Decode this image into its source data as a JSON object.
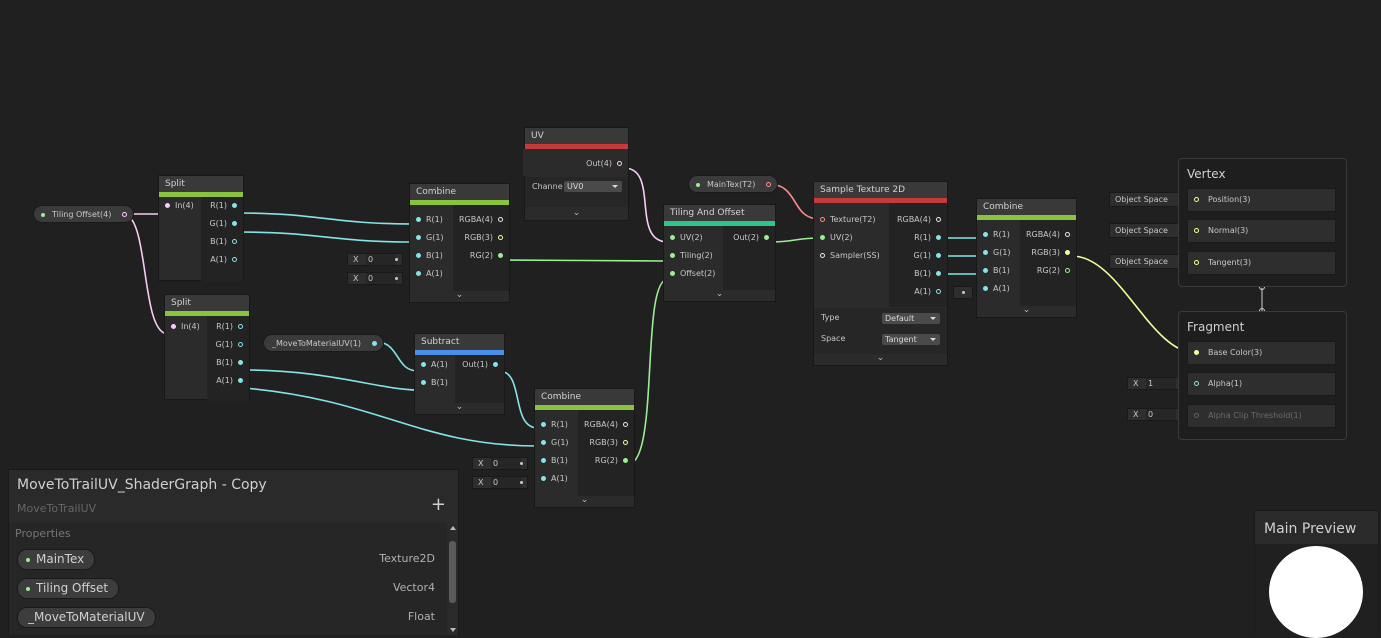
{
  "nodes": {
    "split1": {
      "title": "Split",
      "inputs": [
        "In(4)"
      ],
      "outputs": [
        "R(1)",
        "G(1)",
        "B(1)",
        "A(1)"
      ]
    },
    "split2": {
      "title": "Split",
      "inputs": [
        "In(4)"
      ],
      "outputs": [
        "R(1)",
        "G(1)",
        "B(1)",
        "A(1)"
      ]
    },
    "combine1": {
      "title": "Combine",
      "inputs": [
        "R(1)",
        "G(1)",
        "B(1)",
        "A(1)"
      ],
      "outputs": [
        "RGBA(4)",
        "RGB(3)",
        "RG(2)"
      ],
      "defaults": {
        "b": "0",
        "a": "0"
      }
    },
    "uv": {
      "title": "UV",
      "output": "Out(4)",
      "channel_label": "Channe",
      "channel_value": "UV0"
    },
    "subtract": {
      "title": "Subtract",
      "inputs": [
        "A(1)",
        "B(1)"
      ],
      "output": "Out(1)"
    },
    "combine2": {
      "title": "Combine",
      "inputs": [
        "R(1)",
        "G(1)",
        "B(1)",
        "A(1)"
      ],
      "outputs": [
        "RGBA(4)",
        "RGB(3)",
        "RG(2)"
      ],
      "defaults": {
        "b": "0",
        "a": "0"
      }
    },
    "tiling": {
      "title": "Tiling And Offset",
      "inputs": [
        "UV(2)",
        "Tiling(2)",
        "Offset(2)"
      ],
      "output": "Out(2)"
    },
    "sample": {
      "title": "Sample Texture 2D",
      "inputs": [
        "Texture(T2)",
        "UV(2)",
        "Sampler(SS)"
      ],
      "outputs": [
        "RGBA(4)",
        "R(1)",
        "G(1)",
        "B(1)",
        "A(1)"
      ],
      "type_label": "Type",
      "type_value": "Default",
      "space_label": "Space",
      "space_value": "Tangent"
    },
    "combine3": {
      "title": "Combine",
      "inputs": [
        "R(1)",
        "G(1)",
        "B(1)",
        "A(1)"
      ],
      "outputs": [
        "RGBA(4)",
        "RGB(3)",
        "RG(2)"
      ]
    }
  },
  "property_nodes": {
    "tiling_offset": "Tiling Offset(4)",
    "main_tex": "MainTex(T2)",
    "move_uv": "_MoveToMaterialUV(1)"
  },
  "vertex": {
    "title": "Vertex",
    "slots": [
      "Position(3)",
      "Normal(3)",
      "Tangent(3)"
    ],
    "spaces": [
      "Object Space",
      "Object Space",
      "Object Space"
    ]
  },
  "fragment": {
    "title": "Fragment",
    "slots": [
      "Base Color(3)",
      "Alpha(1)",
      "Alpha Clip Threshold(1)"
    ],
    "alpha_value": "1",
    "clip_value": "0"
  },
  "blackboard": {
    "title": "MoveToTrailUV_ShaderGraph - Copy",
    "subtitle": "MoveToTrailUV",
    "add_label": "+",
    "section": "Properties",
    "properties": [
      {
        "name": "MainTex",
        "type": "Texture2D"
      },
      {
        "name": "Tiling Offset",
        "type": "Vector4"
      },
      {
        "name": "_MoveToMaterialUV",
        "type": "Float"
      }
    ]
  },
  "preview": {
    "title": "Main Preview"
  },
  "colors": {
    "canvas": "#202020",
    "vector1": "#84e4e7",
    "vector2": "#9aef92",
    "vector3": "#f6ff9a",
    "vector4": "#fbcbf4",
    "texture": "#ff8b8b",
    "split_bar": "#8ac43f",
    "uv_bar": "#c53a3a",
    "subtract_bar": "#4a8ee6",
    "tiling_bar": "#2fc48a"
  }
}
